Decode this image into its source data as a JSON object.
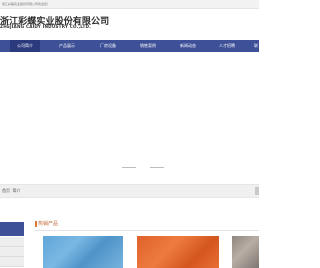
{
  "topbar": {
    "text": "浙江彩蝶实业股份有限公司欢迎您！"
  },
  "logo": {
    "cn": "浙江彩蝶实业股份有限公司",
    "en": "ZHEJIANG CAIDY INDUSTRY CO.,LTD."
  },
  "nav": {
    "items": [
      {
        "label": "公司简介"
      },
      {
        "label": "产品展示"
      },
      {
        "label": "厂房设备"
      },
      {
        "label": "销售案例"
      },
      {
        "label": "新闻动态"
      },
      {
        "label": "人才招聘"
      },
      {
        "label": "联"
      }
    ]
  },
  "location": {
    "label": "首页",
    "sub": "简介"
  },
  "hot_products": {
    "title": "热销产品"
  },
  "colors": {
    "nav_bg": "#3d5098",
    "accent": "#e07a3a"
  }
}
